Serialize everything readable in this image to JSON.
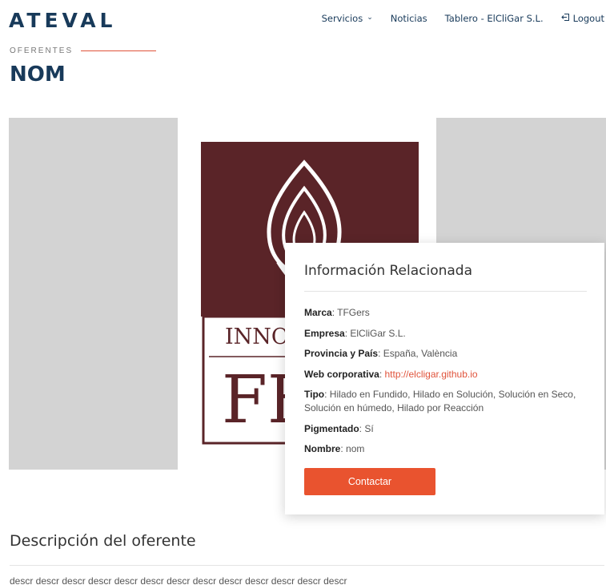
{
  "header": {
    "logo": "ATEVAL",
    "nav": {
      "servicios": "Servicios",
      "noticias": "Noticias",
      "tablero": "Tablero - ElCliGar S.L.",
      "logout": "Logout"
    }
  },
  "section": {
    "eyebrow": "OFERENTES",
    "title": "NOM"
  },
  "logo_image": {
    "text_top": "INNO",
    "text_bottom": "FE"
  },
  "card": {
    "title": "Información Relacionada",
    "rows": [
      {
        "label": "Marca",
        "value": "TFGers"
      },
      {
        "label": "Empresa",
        "value": "ElCliGar S.L."
      },
      {
        "label": "Provincia y País",
        "value": "España, València"
      },
      {
        "label": "Web corporativa",
        "value": "http://elcligar.github.io"
      },
      {
        "label": "Tipo",
        "value": "Hilado en Fundido, Hilado en Solución, Solución en Seco, Solución en húmedo, Hilado por Reacción"
      },
      {
        "label": "Pigmentado",
        "value": "Sí"
      },
      {
        "label": "Nombre",
        "value": "nom"
      }
    ],
    "button": "Contactar"
  },
  "description": {
    "title": "Descripción del oferente",
    "text": "descr descr descr descr descr descr descr descr descr descr descr descr descr"
  },
  "colors": {
    "brand": "#183a5a",
    "accent": "#e9532f",
    "logo_bg": "#5a2428"
  }
}
